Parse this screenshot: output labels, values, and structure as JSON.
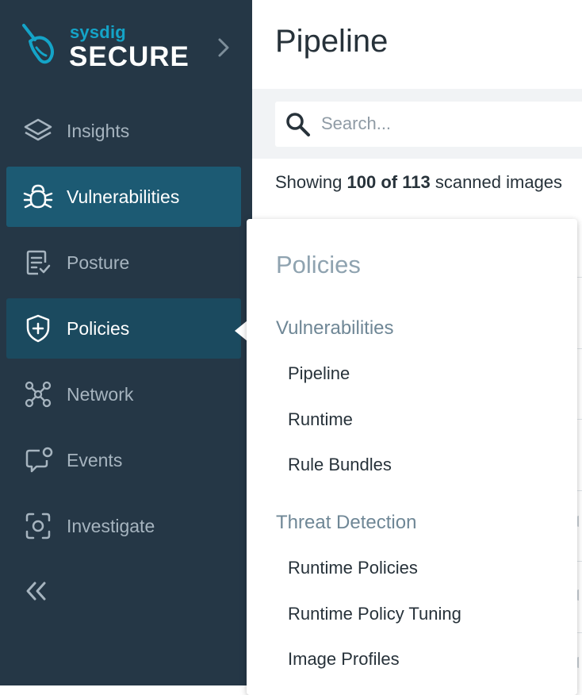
{
  "brand": {
    "name": "sysdig",
    "product": "SECURE",
    "accent_color": "#14a4c8",
    "logo_icon": "shovel-icon",
    "expand_icon": "chevron-right-icon"
  },
  "sidebar": {
    "background": "#253746",
    "items": [
      {
        "label": "Insights",
        "icon": "layers-icon",
        "state": "default"
      },
      {
        "label": "Vulnerabilities",
        "icon": "bug-icon",
        "state": "active"
      },
      {
        "label": "Posture",
        "icon": "checklist-icon",
        "state": "default"
      },
      {
        "label": "Policies",
        "icon": "shield-plus-icon",
        "state": "selected"
      },
      {
        "label": "Network",
        "icon": "network-nodes-icon",
        "state": "default"
      },
      {
        "label": "Events",
        "icon": "chat-alert-icon",
        "state": "default"
      },
      {
        "label": "Investigate",
        "icon": "capture-icon",
        "state": "default"
      }
    ],
    "collapse_icon": "double-chevron-left-icon"
  },
  "main": {
    "title": "Pipeline",
    "search": {
      "placeholder": "Search...",
      "value": ""
    },
    "showing": {
      "prefix": "Showing",
      "count": "100 of 113",
      "suffix": "scanned images"
    }
  },
  "flyout": {
    "title": "Policies",
    "sections": [
      {
        "label": "Vulnerabilities",
        "links": [
          "Pipeline",
          "Runtime",
          "Rule Bundles"
        ]
      },
      {
        "label": "Threat Detection",
        "links": [
          "Runtime Policies",
          "Runtime Policy Tuning",
          "Image Profiles"
        ]
      }
    ]
  }
}
